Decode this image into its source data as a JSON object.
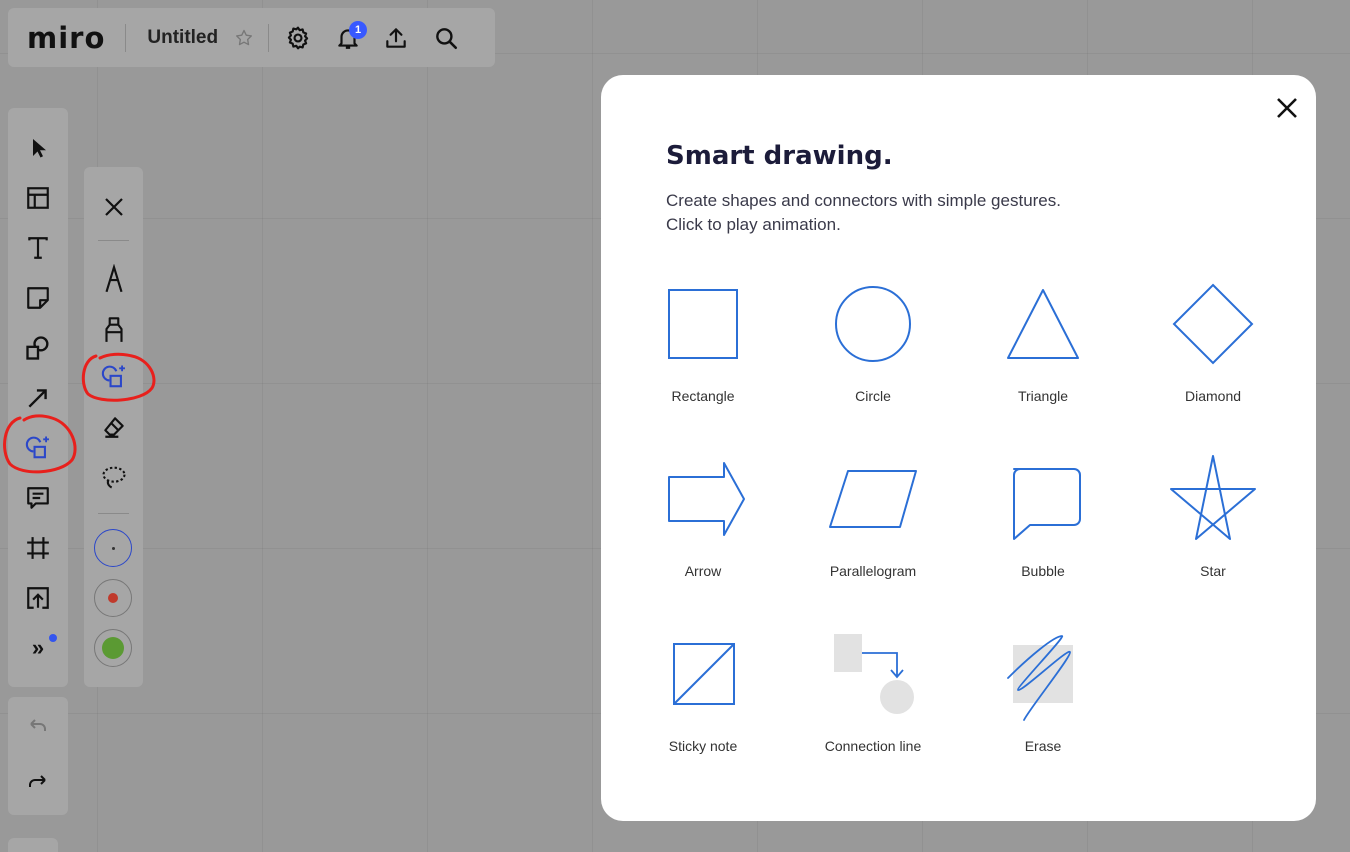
{
  "app": {
    "logo": "miro",
    "board_title": "Untitled",
    "notification_count": "1"
  },
  "toolbar": {
    "tools": [
      {
        "name": "select-tool",
        "icon": "cursor-arrow-icon"
      },
      {
        "name": "templates-tool",
        "icon": "layout-icon"
      },
      {
        "name": "text-tool",
        "icon": "text-icon"
      },
      {
        "name": "sticky-note-tool",
        "icon": "sticky-note-icon"
      },
      {
        "name": "shapes-tool",
        "icon": "shapes-icon"
      },
      {
        "name": "connection-line-tool",
        "icon": "arrow-line-icon"
      },
      {
        "name": "smart-drawing-tool",
        "icon": "smart-drawing-icon"
      },
      {
        "name": "comment-tool",
        "icon": "comment-icon"
      },
      {
        "name": "frame-tool",
        "icon": "frame-icon"
      },
      {
        "name": "upload-tool",
        "icon": "upload-icon"
      },
      {
        "name": "more-tools",
        "icon": "double-chevron-icon"
      }
    ],
    "more_label": "»"
  },
  "pen_panel": {
    "tools": [
      "close-icon",
      "pen-icon",
      "marker-icon",
      "smart-drawing-icon",
      "eraser-icon",
      "lasso-icon"
    ],
    "swatches": [
      {
        "name": "blue-thin",
        "color": "#2b47c9",
        "dot": "#333333"
      },
      {
        "name": "red",
        "color": "#a6a6a6",
        "dot": "#c0392b"
      },
      {
        "name": "green",
        "color": "#a6a6a6",
        "dot": "#5b9a33"
      }
    ]
  },
  "colors": {
    "accent_blue": "#2b6fd6",
    "badge_blue": "#3859ff",
    "annotation_red": "#e8201c"
  },
  "modal": {
    "title": "Smart drawing.",
    "description_line1": "Create shapes and connectors with simple gestures.",
    "description_line2": "Click to play animation.",
    "gestures": [
      {
        "label": "Rectangle",
        "icon": "rectangle-icon"
      },
      {
        "label": "Circle",
        "icon": "circle-icon"
      },
      {
        "label": "Triangle",
        "icon": "triangle-icon"
      },
      {
        "label": "Diamond",
        "icon": "diamond-icon"
      },
      {
        "label": "Arrow",
        "icon": "arrow-shape-icon"
      },
      {
        "label": "Parallelogram",
        "icon": "parallelogram-icon"
      },
      {
        "label": "Bubble",
        "icon": "bubble-icon"
      },
      {
        "label": "Star",
        "icon": "star-icon"
      },
      {
        "label": "Sticky note",
        "icon": "sticky-note-gesture-icon"
      },
      {
        "label": "Connection line",
        "icon": "connection-line-icon"
      },
      {
        "label": "Erase",
        "icon": "erase-scribble-icon"
      }
    ]
  }
}
